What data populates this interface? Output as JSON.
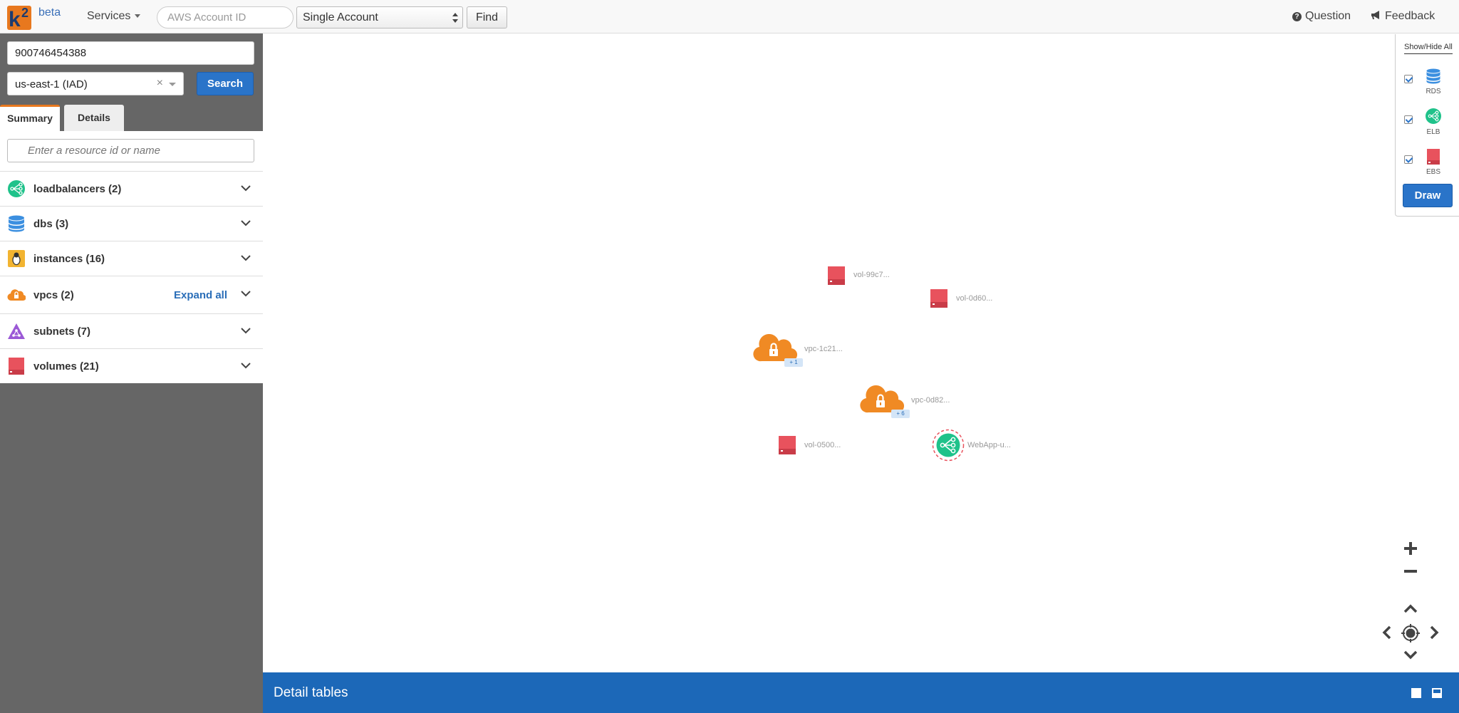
{
  "app": {
    "beta_label": "beta"
  },
  "topbar": {
    "services_label": "Services",
    "account_placeholder": "AWS Account ID",
    "account_mode": "Single Account",
    "find_label": "Find",
    "question_label": "Question",
    "feedback_label": "Feedback"
  },
  "sidebar": {
    "account_id": "900746454388",
    "region": "us-east-1 (IAD)",
    "search_label": "Search",
    "tabs": [
      {
        "label": "Summary"
      },
      {
        "label": "Details"
      }
    ],
    "filter_placeholder": "Enter a resource id or name",
    "resources": [
      {
        "label": "loadbalancers (2)",
        "icon": "load-balancer-icon"
      },
      {
        "label": "dbs (3)",
        "icon": "database-icon"
      },
      {
        "label": "instances (16)",
        "icon": "linux-instance-icon"
      },
      {
        "label": "vpcs (2)",
        "icon": "vpc-cloud-lock-icon",
        "action": "Expand all"
      },
      {
        "label": "subnets (7)",
        "icon": "subnet-icon"
      },
      {
        "label": "volumes (21)",
        "icon": "volume-icon"
      }
    ]
  },
  "graph": {
    "nodes": [
      {
        "label": "vol-99c7...",
        "type": "volume"
      },
      {
        "label": "vol-0d60...",
        "type": "volume"
      },
      {
        "label": "vpc-1c21...",
        "type": "vpc",
        "badge": "+ 1"
      },
      {
        "label": "vpc-0d82...",
        "type": "vpc",
        "badge": "+ 6"
      },
      {
        "label": "vol-0500...",
        "type": "volume"
      },
      {
        "label": "WebApp-u...",
        "type": "load-balancer"
      }
    ]
  },
  "legend": {
    "title": "Show/Hide All",
    "items": [
      {
        "label": "RDS",
        "checked": true,
        "color": "#3b8fe0"
      },
      {
        "label": "ELB",
        "checked": true,
        "color": "#1fc28a"
      },
      {
        "label": "EBS",
        "checked": true,
        "color": "#e8525d"
      }
    ],
    "draw_label": "Draw"
  },
  "detail_bar": {
    "title": "Detail tables"
  },
  "colors": {
    "accent_blue": "#2a74c9",
    "detail_bar": "#1c68b8",
    "vpc_orange": "#f08a24",
    "volume_red": "#e8525d",
    "elb_green": "#1fc28a",
    "rds_blue": "#3b8fe0",
    "instance_yellow": "#f2b431",
    "subnet_purple": "#9b59d6"
  }
}
